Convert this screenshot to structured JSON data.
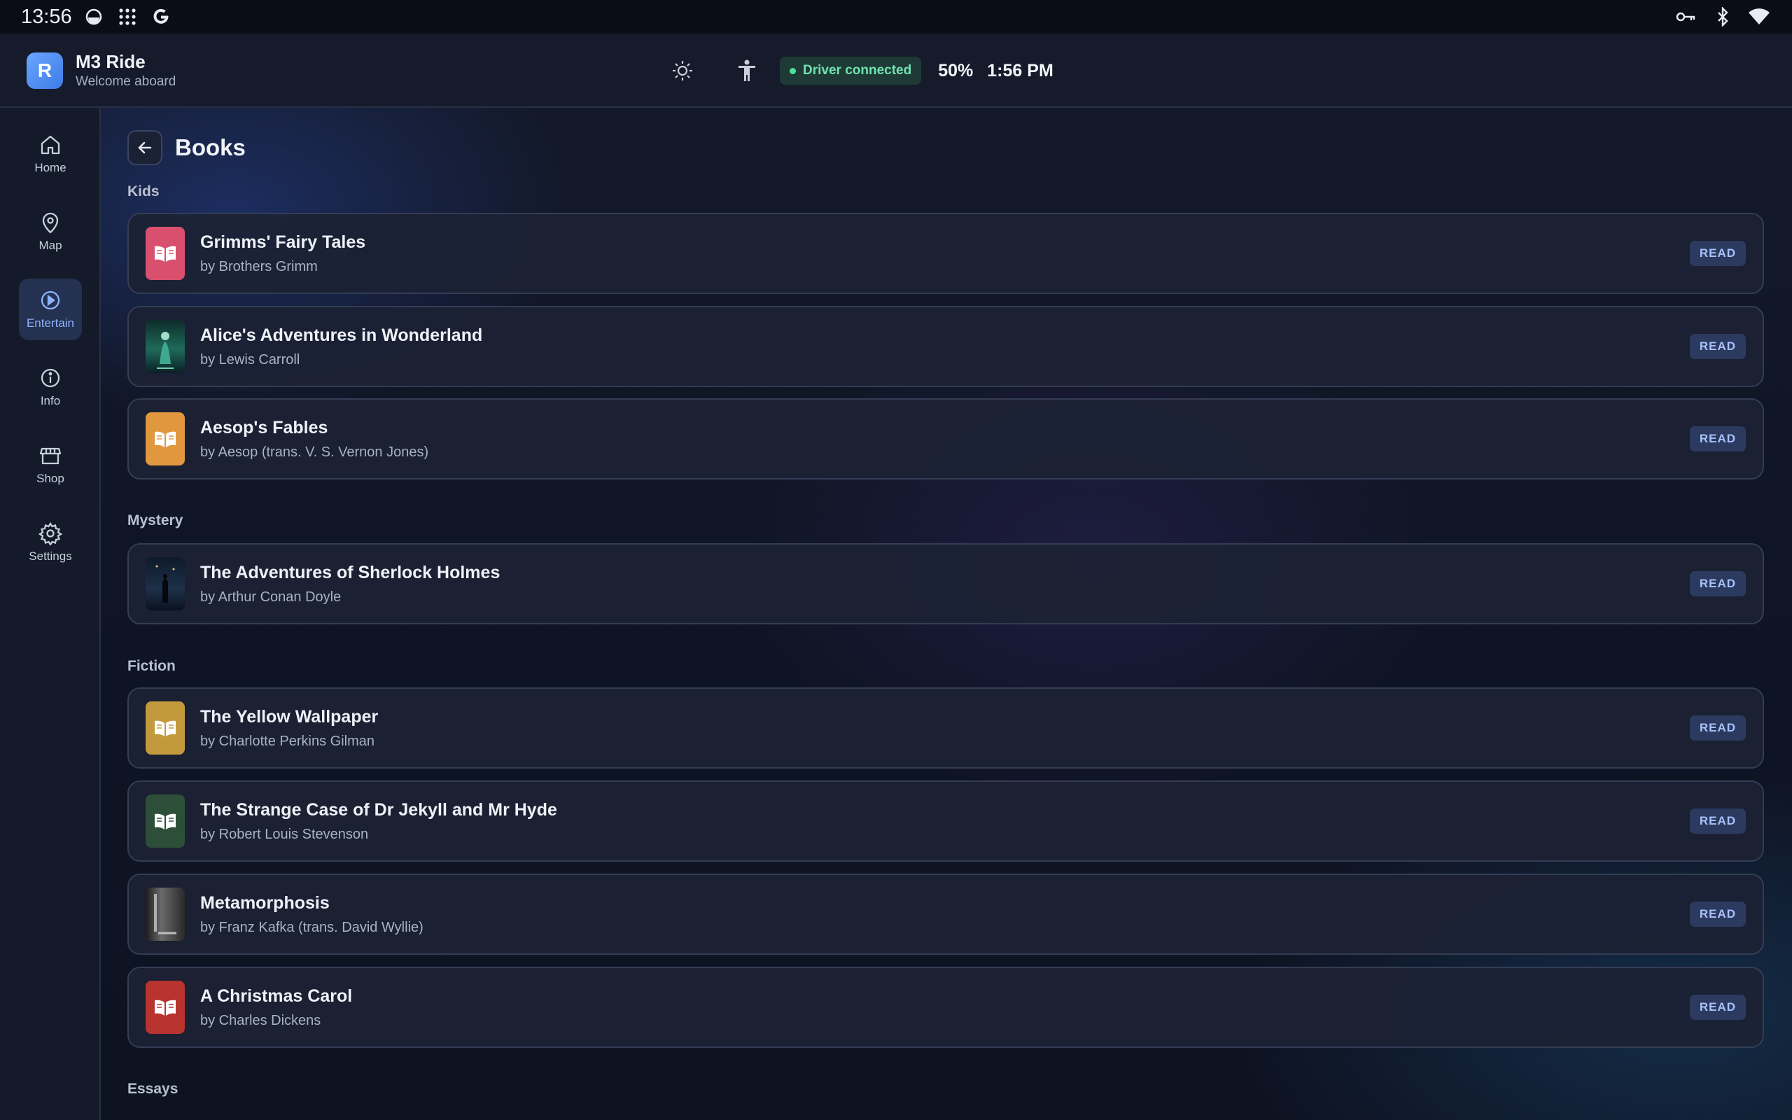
{
  "status_bar": {
    "time": "13:56"
  },
  "app_bar": {
    "avatar_letter": "R",
    "app_name": "M3 Ride",
    "subtitle": "Welcome aboard",
    "driver_status": "Driver connected",
    "battery": "50%",
    "clock": "1:56 PM"
  },
  "sidebar": {
    "items": [
      {
        "label": "Home",
        "icon": "home-icon",
        "active": false
      },
      {
        "label": "Map",
        "icon": "map-pin-icon",
        "active": false
      },
      {
        "label": "Entertain",
        "icon": "play-circle-icon",
        "active": true
      },
      {
        "label": "Info",
        "icon": "info-icon",
        "active": false
      },
      {
        "label": "Shop",
        "icon": "store-icon",
        "active": false
      },
      {
        "label": "Settings",
        "icon": "gear-icon",
        "active": false
      }
    ]
  },
  "page": {
    "title": "Books"
  },
  "sections": [
    {
      "label": "Kids",
      "books": [
        {
          "title": "Grimms' Fairy Tales",
          "author": "by Brothers Grimm",
          "cover": "book-icon",
          "color": "#d9506e",
          "action": "READ"
        },
        {
          "title": "Alice's Adventures in Wonderland",
          "author": "by Lewis Carroll",
          "cover": "cover-image",
          "color": "#1f6a5a",
          "action": "READ"
        },
        {
          "title": "Aesop's Fables",
          "author": "by Aesop (trans. V. S. Vernon Jones)",
          "cover": "book-icon",
          "color": "#e0973e",
          "action": "READ"
        }
      ]
    },
    {
      "label": "Mystery",
      "books": [
        {
          "title": "The Adventures of Sherlock Holmes",
          "author": "by Arthur Conan Doyle",
          "cover": "cover-image",
          "color": "#1d3048",
          "action": "READ"
        }
      ]
    },
    {
      "label": "Fiction",
      "books": [
        {
          "title": "The Yellow Wallpaper",
          "author": "by Charlotte Perkins Gilman",
          "cover": "book-icon",
          "color": "#c29a3c",
          "action": "READ"
        },
        {
          "title": "The Strange Case of Dr Jekyll and Mr Hyde",
          "author": "by Robert Louis Stevenson",
          "cover": "book-icon",
          "color": "#2d4f3a",
          "action": "READ"
        },
        {
          "title": "Metamorphosis",
          "author": "by Franz Kafka (trans. David Wyllie)",
          "cover": "cover-image",
          "color": "#3a3a3a",
          "action": "READ"
        },
        {
          "title": "A Christmas Carol",
          "author": "by Charles Dickens",
          "cover": "book-icon",
          "color": "#b8322e",
          "action": "READ"
        }
      ]
    },
    {
      "label": "Essays",
      "books": []
    }
  ]
}
